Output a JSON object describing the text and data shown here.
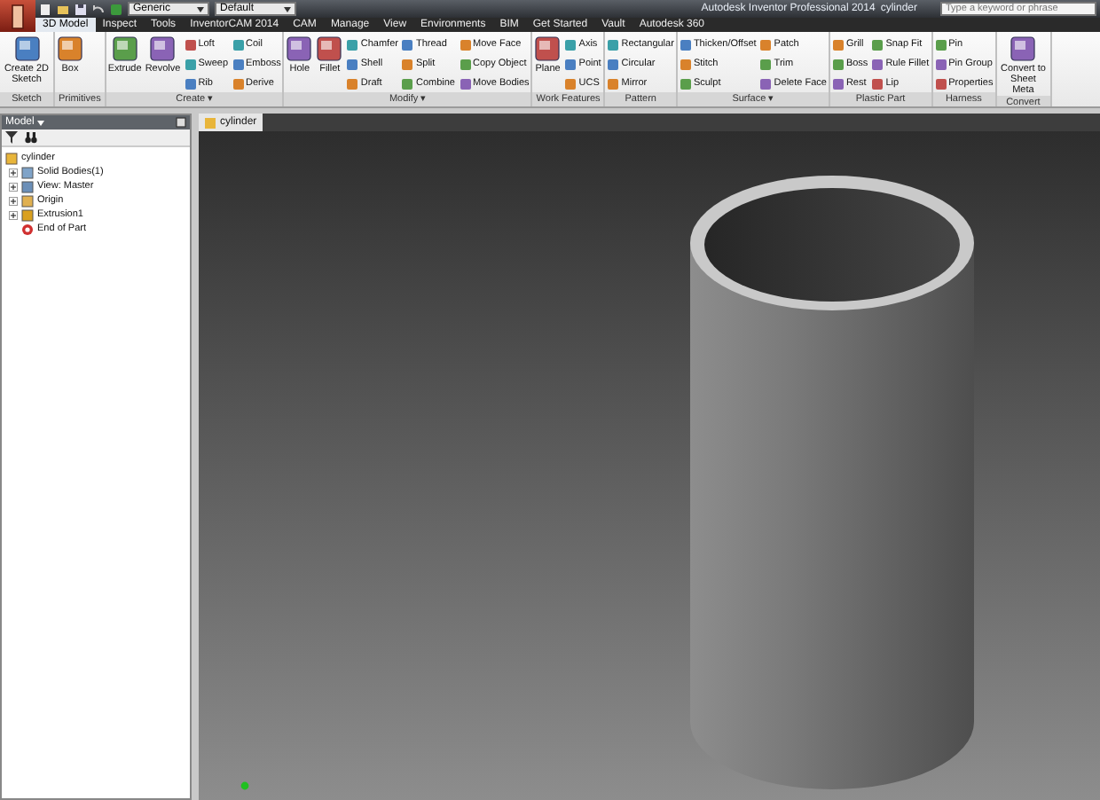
{
  "title_bar": {
    "material": "Generic",
    "appearance": "Default",
    "title": "Autodesk Inventor Professional 2014",
    "document": "cylinder",
    "search_placeholder": "Type a keyword or phrase"
  },
  "tabs": [
    {
      "label": "3D Model",
      "selected": true
    },
    {
      "label": "Inspect",
      "selected": false
    },
    {
      "label": "Tools",
      "selected": false
    },
    {
      "label": "InventorCAM 2014",
      "selected": false
    },
    {
      "label": "CAM",
      "selected": false
    },
    {
      "label": "Manage",
      "selected": false
    },
    {
      "label": "View",
      "selected": false
    },
    {
      "label": "Environments",
      "selected": false
    },
    {
      "label": "BIM",
      "selected": false
    },
    {
      "label": "Get Started",
      "selected": false
    },
    {
      "label": "Vault",
      "selected": false
    },
    {
      "label": "Autodesk 360",
      "selected": false
    }
  ],
  "ribbon": {
    "panels": [
      {
        "label": "Sketch",
        "groups": [
          {
            "kind": "large",
            "label": "Create 2D Sketch"
          }
        ]
      },
      {
        "label": "Primitives",
        "groups": [
          {
            "kind": "large",
            "label": "Box"
          }
        ]
      },
      {
        "label": "Create ▾",
        "groups": [
          {
            "kind": "large",
            "label": "Extrude"
          },
          {
            "kind": "large",
            "label": "Revolve"
          },
          {
            "kind": "column",
            "tools": [
              "Loft",
              "Sweep",
              "Rib"
            ]
          },
          {
            "kind": "column",
            "tools": [
              "Coil",
              "Emboss",
              "Derive"
            ]
          }
        ]
      },
      {
        "label": "Modify ▾",
        "groups": [
          {
            "kind": "large",
            "label": "Hole"
          },
          {
            "kind": "large",
            "label": "Fillet"
          },
          {
            "kind": "column",
            "tools": [
              "Chamfer",
              "Shell",
              "Draft"
            ]
          },
          {
            "kind": "column",
            "tools": [
              "Thread",
              "Split",
              "Combine"
            ]
          },
          {
            "kind": "column",
            "tools": [
              "Move Face",
              "Copy Object",
              "Move Bodies"
            ]
          }
        ]
      },
      {
        "label": "Work Features",
        "groups": [
          {
            "kind": "large",
            "label": "Plane"
          },
          {
            "kind": "column",
            "tools": [
              "Axis",
              "Point",
              "UCS"
            ]
          }
        ]
      },
      {
        "label": "Pattern",
        "groups": [
          {
            "kind": "column",
            "tools": [
              "Rectangular",
              "Circular",
              "Mirror"
            ]
          }
        ]
      },
      {
        "label": "Surface ▾",
        "groups": [
          {
            "kind": "column",
            "tools": [
              "Thicken/Offset",
              "Stitch",
              "Sculpt"
            ]
          },
          {
            "kind": "column",
            "tools": [
              "Patch",
              "Trim",
              "Delete Face"
            ]
          }
        ]
      },
      {
        "label": "Plastic Part",
        "groups": [
          {
            "kind": "column",
            "tools": [
              "Grill",
              "Boss",
              "Rest"
            ]
          },
          {
            "kind": "column",
            "tools": [
              "Snap Fit",
              "Rule Fillet",
              "Lip"
            ]
          }
        ]
      },
      {
        "label": "Harness",
        "groups": [
          {
            "kind": "column",
            "tools": [
              "Pin",
              "Pin Group",
              "Properties"
            ]
          }
        ]
      },
      {
        "label": "Convert",
        "groups": [
          {
            "kind": "large",
            "label": "Convert to Sheet Meta"
          }
        ]
      }
    ]
  },
  "browser": {
    "title": "Model",
    "tree": [
      {
        "label": "cylinder",
        "kind": "part",
        "children": [
          {
            "label": "Solid Bodies(1)",
            "kind": "bodies",
            "expanded": false
          },
          {
            "label": "View: Master",
            "kind": "view",
            "expanded": false
          },
          {
            "label": "Origin",
            "kind": "origin",
            "expanded": false
          },
          {
            "label": "Extrusion1",
            "kind": "feature",
            "expanded": false
          },
          {
            "label": "End of Part",
            "kind": "end"
          }
        ]
      }
    ]
  },
  "viewport": {
    "tab": "cylinder"
  }
}
